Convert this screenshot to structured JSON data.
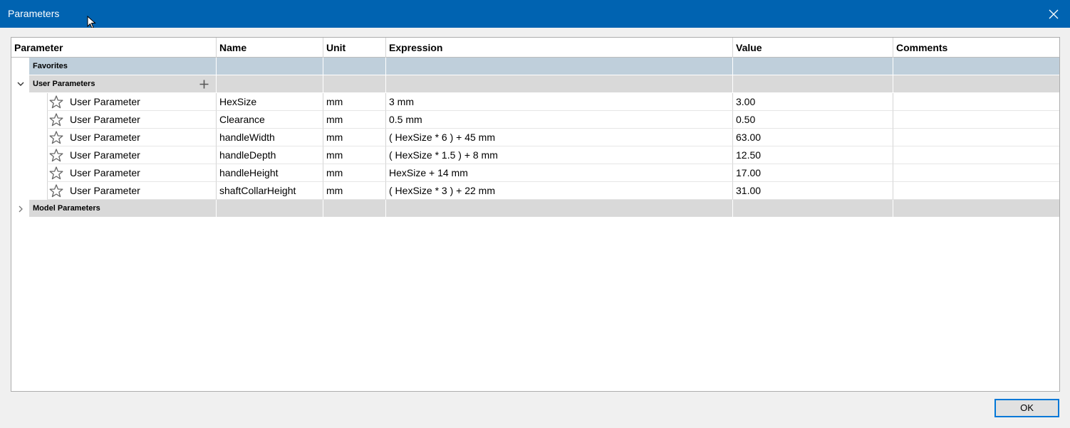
{
  "window": {
    "title": "Parameters"
  },
  "table": {
    "columns": [
      "Parameter",
      "Name",
      "Unit",
      "Expression",
      "Value",
      "Comments"
    ],
    "favorites_label": "Favorites",
    "user_group_label": "User Parameters",
    "model_group_label": "Model Parameters",
    "rows": [
      {
        "parameter": "User Parameter",
        "name": "HexSize",
        "unit": "mm",
        "expression": "3 mm",
        "value": "3.00",
        "comments": ""
      },
      {
        "parameter": "User Parameter",
        "name": "Clearance",
        "unit": "mm",
        "expression": "0.5 mm",
        "value": "0.50",
        "comments": ""
      },
      {
        "parameter": "User Parameter",
        "name": "handleWidth",
        "unit": "mm",
        "expression": "( HexSize * 6 ) + 45 mm",
        "value": "63.00",
        "comments": ""
      },
      {
        "parameter": "User Parameter",
        "name": "handleDepth",
        "unit": "mm",
        "expression": "( HexSize * 1.5 ) + 8 mm",
        "value": "12.50",
        "comments": ""
      },
      {
        "parameter": "User Parameter",
        "name": "handleHeight",
        "unit": "mm",
        "expression": "HexSize + 14 mm",
        "value": "17.00",
        "comments": ""
      },
      {
        "parameter": "User Parameter",
        "name": "shaftCollarHeight",
        "unit": "mm",
        "expression": "( HexSize * 3 ) + 22 mm",
        "value": "31.00",
        "comments": ""
      }
    ]
  },
  "footer": {
    "ok_label": "OK"
  },
  "icons": {
    "close": "close-icon",
    "star": "star-icon",
    "add": "plus-icon",
    "expand": "chevron-down-icon",
    "collapse": "chevron-right-icon"
  }
}
